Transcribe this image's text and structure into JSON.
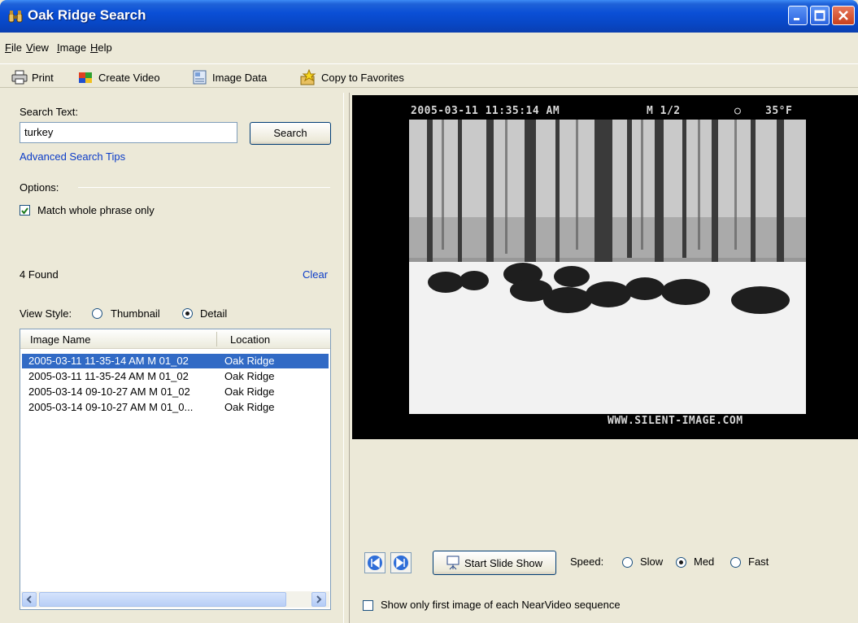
{
  "window": {
    "title": "Oak Ridge Search"
  },
  "menu": [
    {
      "label": "File",
      "u": "F",
      "rest": "ile"
    },
    {
      "label": "View",
      "u": "V",
      "rest": "iew"
    },
    {
      "label": "Image",
      "u": "I",
      "rest": "mage"
    },
    {
      "label": "Help",
      "u": "H",
      "rest": "elp"
    }
  ],
  "toolbar": {
    "print": "Print",
    "create_video": "Create Video",
    "image_data": "Image Data",
    "copy_favorites": "Copy to Favorites"
  },
  "search": {
    "label": "Search Text:",
    "value": "turkey",
    "button": "Search",
    "tips_link": "Advanced Search Tips"
  },
  "options": {
    "label": "Options:",
    "match_whole": "Match whole phrase only",
    "match_whole_checked": true
  },
  "results": {
    "found": "4 Found",
    "clear": "Clear"
  },
  "view_style": {
    "label": "View Style:",
    "thumbnail": "Thumbnail",
    "detail": "Detail",
    "selected": "Detail"
  },
  "list": {
    "columns": [
      "Image Name",
      "Location"
    ],
    "rows": [
      {
        "name": "2005-03-11 11-35-14 AM M 01_02",
        "location": "Oak Ridge",
        "selected": true
      },
      {
        "name": "2005-03-11 11-35-24 AM M 01_02",
        "location": "Oak Ridge",
        "selected": false
      },
      {
        "name": "2005-03-14 09-10-27 AM M 01_02",
        "location": "Oak Ridge",
        "selected": false
      },
      {
        "name": "2005-03-14 09-10-27 AM M 01_0...",
        "location": "Oak Ridge",
        "selected": false
      }
    ]
  },
  "image": {
    "stamp_datetime": "2005-03-11 11:35:14 AM",
    "stamp_sequence": "M 1/2",
    "stamp_moon": "○",
    "stamp_temp": "35°F",
    "watermark": "WWW.SILENT-IMAGE.COM"
  },
  "slideshow": {
    "start": "Start Slide Show",
    "speed_label": "Speed:",
    "slow": "Slow",
    "med": "Med",
    "fast": "Fast",
    "speed_selected": "Med",
    "first_only": "Show only first image of each NearVideo sequence",
    "first_only_checked": false
  },
  "colors": {
    "titlebar": "#0a4fd6",
    "selection": "#316ac5",
    "link": "#0b3cc8",
    "face": "#ece9d8"
  }
}
